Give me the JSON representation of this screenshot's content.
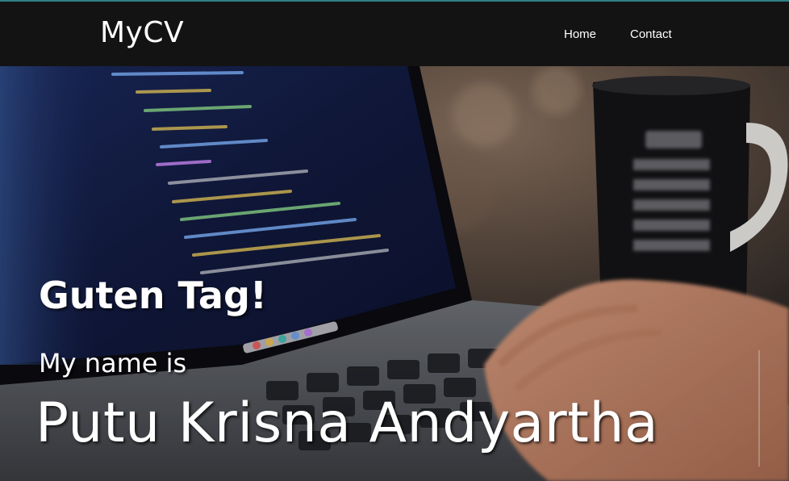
{
  "navbar": {
    "brand": "MyCV",
    "links": [
      {
        "label": "Home"
      },
      {
        "label": "Contact"
      }
    ]
  },
  "hero": {
    "greeting": "Guten Tag!",
    "intro": "My name is",
    "name": "Putu Krisna Andyartha",
    "background": "laptop-coding-photo"
  },
  "colors": {
    "navbar_bg": "#131313",
    "accent_line": "#2f7f86",
    "text": "#ffffff"
  }
}
